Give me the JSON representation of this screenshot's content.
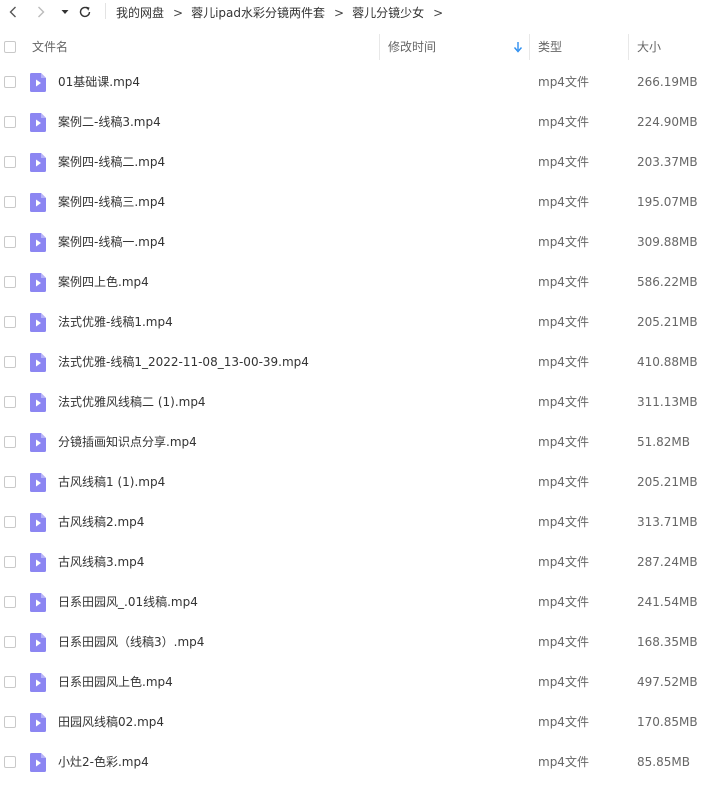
{
  "nav": {
    "breadcrumb": [
      "我的网盘",
      "蓉儿ipad水彩分镜两件套",
      "蓉儿分镜少女"
    ],
    "separator": ">"
  },
  "columns": {
    "name": "文件名",
    "modified": "修改时间",
    "type": "类型",
    "size": "大小"
  },
  "colors": {
    "icon": "#8c86f2",
    "sort_arrow": "#2e8ff0",
    "text": "#333333"
  },
  "files": [
    {
      "name": "01基础课.mp4",
      "type": "mp4文件",
      "size": "266.19MB"
    },
    {
      "name": "案例二-线稿3.mp4",
      "type": "mp4文件",
      "size": "224.90MB"
    },
    {
      "name": "案例四-线稿二.mp4",
      "type": "mp4文件",
      "size": "203.37MB"
    },
    {
      "name": "案例四-线稿三.mp4",
      "type": "mp4文件",
      "size": "195.07MB"
    },
    {
      "name": "案例四-线稿一.mp4",
      "type": "mp4文件",
      "size": "309.88MB"
    },
    {
      "name": "案例四上色.mp4",
      "type": "mp4文件",
      "size": "586.22MB"
    },
    {
      "name": "法式优雅-线稿1.mp4",
      "type": "mp4文件",
      "size": "205.21MB"
    },
    {
      "name": "法式优雅-线稿1_2022-11-08_13-00-39.mp4",
      "type": "mp4文件",
      "size": "410.88MB"
    },
    {
      "name": "法式优雅风线稿二 (1).mp4",
      "type": "mp4文件",
      "size": "311.13MB"
    },
    {
      "name": "分镜插画知识点分享.mp4",
      "type": "mp4文件",
      "size": "51.82MB"
    },
    {
      "name": "古风线稿1 (1).mp4",
      "type": "mp4文件",
      "size": "205.21MB"
    },
    {
      "name": "古风线稿2.mp4",
      "type": "mp4文件",
      "size": "313.71MB"
    },
    {
      "name": "古风线稿3.mp4",
      "type": "mp4文件",
      "size": "287.24MB"
    },
    {
      "name": "日系田园风_.01线稿.mp4",
      "type": "mp4文件",
      "size": "241.54MB"
    },
    {
      "name": "日系田园风（线稿3）.mp4",
      "type": "mp4文件",
      "size": "168.35MB"
    },
    {
      "name": "日系田园风上色.mp4",
      "type": "mp4文件",
      "size": "497.52MB"
    },
    {
      "name": "田园风线稿02.mp4",
      "type": "mp4文件",
      "size": "170.85MB"
    },
    {
      "name": "小灶2-色彩.mp4",
      "type": "mp4文件",
      "size": "85.85MB"
    }
  ]
}
